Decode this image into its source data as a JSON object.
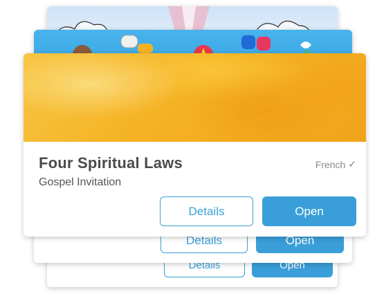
{
  "resource": {
    "title": "Four Spiritual Laws",
    "subtitle": "Gospel Invitation",
    "language": "French",
    "language_status_icon": "checkmark-icon",
    "details_label": "Details",
    "open_label": "Open"
  },
  "stacked_cards": [
    {
      "details_label": "Details",
      "open_label": "Open"
    },
    {
      "details_label": "Details",
      "open_label": "Open"
    }
  ],
  "colors": {
    "accent": "#3a9fd9",
    "banner_front": "#f5b224",
    "banner_middle": "#48b3ec",
    "banner_back": "#cfe3f7"
  }
}
